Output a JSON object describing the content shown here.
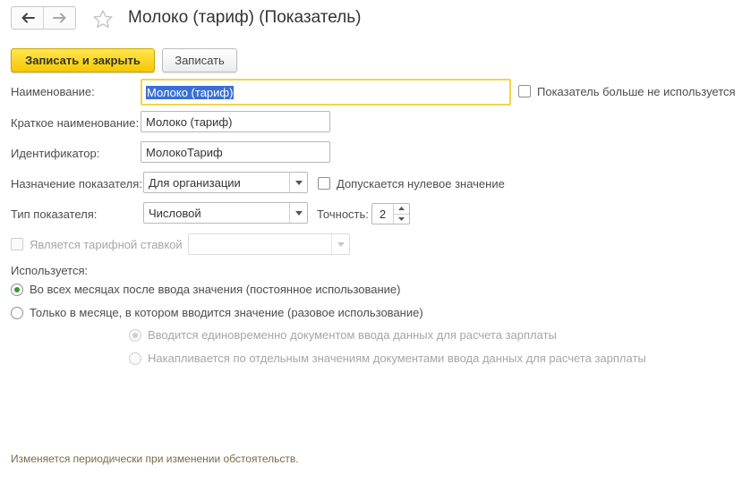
{
  "header": {
    "title": "Молоко (тариф) (Показатель)",
    "back_icon": "arrow-left-icon",
    "forward_icon": "arrow-right-icon",
    "favorite_icon": "star-icon"
  },
  "toolbar": {
    "save_close_label": "Записать и закрыть",
    "save_label": "Записать"
  },
  "form": {
    "name": {
      "label": "Наименование:",
      "value": "Молоко (тариф)"
    },
    "not_used": {
      "label": "Показатель больше не используется",
      "checked": false
    },
    "short_name": {
      "label": "Краткое наименование:",
      "value": "Молоко (тариф)"
    },
    "identifier": {
      "label": "Идентификатор:",
      "value": "МолокоТариф"
    },
    "purpose": {
      "label": "Назначение показателя:",
      "value": "Для организации"
    },
    "zero_allowed": {
      "label": "Допускается нулевое значение",
      "checked": false
    },
    "type": {
      "label": "Тип показателя:",
      "value": "Числовой"
    },
    "precision": {
      "label": "Точность:",
      "value": "2"
    },
    "tariff_rate": {
      "label": "Является тарифной ставкой",
      "checked": false,
      "value": ""
    },
    "usage": {
      "label": "Используется:",
      "options": [
        {
          "label": "Во всех месяцах после ввода значения (постоянное использование)",
          "checked": true
        },
        {
          "label": "Только в месяце, в котором вводится значение (разовое использование)",
          "checked": false
        }
      ],
      "sub_options": [
        {
          "label": "Вводится единовременно документом ввода данных для расчета зарплаты",
          "checked": true
        },
        {
          "label": "Накапливается по отдельным значениям документами ввода данных для расчета зарплаты",
          "checked": false
        }
      ]
    }
  },
  "footer": {
    "note": "Изменяется периодически при изменении обстоятельств."
  },
  "colors": {
    "primary_button": "#f5c800",
    "focus_border": "#f1d64b",
    "selection": "#3b6fd4",
    "radio_checked": "#2f9a2f",
    "footer_text": "#7a6a48"
  }
}
